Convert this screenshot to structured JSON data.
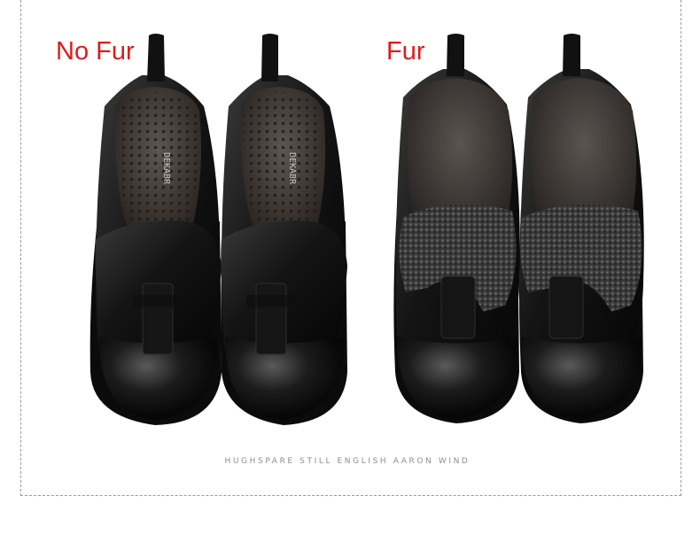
{
  "labels": {
    "left": "No Fur",
    "right": "Fur"
  },
  "caption": "HUGHSPARE STILL ENGLISH AARON WIND",
  "insole_brand": "DEKABR",
  "colors": {
    "label_red": "#e21a1a",
    "leather": "#1a1a1a",
    "fur": "#4a4a4a",
    "border": "#9a9a9a"
  }
}
